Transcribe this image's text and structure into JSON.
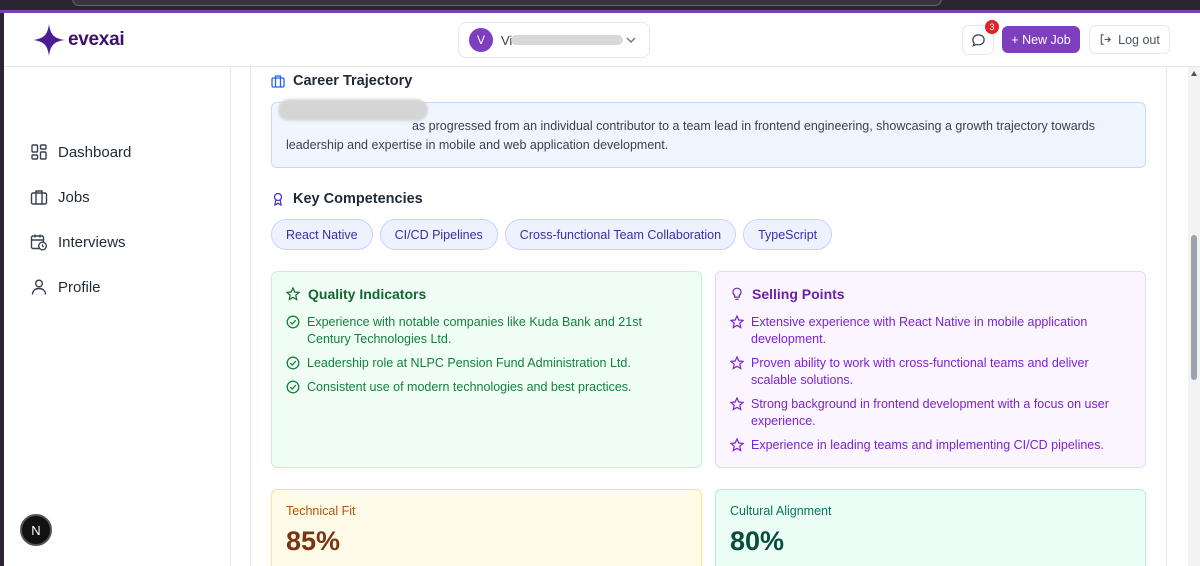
{
  "brand": {
    "name": "evexai",
    "accent": "#7e3fbf"
  },
  "header": {
    "user_initial": "V",
    "user_name": "Vi",
    "messages_count": "3",
    "new_job_label": "+ New Job",
    "logout_label": "Log out"
  },
  "sidebar": {
    "items": [
      {
        "label": "Dashboard",
        "icon": "dashboard-icon"
      },
      {
        "label": "Jobs",
        "icon": "briefcase-icon"
      },
      {
        "label": "Interviews",
        "icon": "calendar-clock-icon"
      },
      {
        "label": "Profile",
        "icon": "user-icon"
      }
    ],
    "help_initial": "N"
  },
  "career": {
    "title": "Career Trajectory",
    "text": "as progressed from an individual contributor to a team lead in frontend engineering, showcasing a growth trajectory towards leadership and expertise in mobile and web application development."
  },
  "competencies": {
    "title": "Key Competencies",
    "tags": [
      "React Native",
      "CI/CD Pipelines",
      "Cross-functional Team Collaboration",
      "TypeScript"
    ]
  },
  "quality": {
    "title": "Quality Indicators",
    "items": [
      "Experience with notable companies like Kuda Bank and 21st Century Technologies Ltd.",
      "Leadership role at NLPC Pension Fund Administration Ltd.",
      "Consistent use of modern technologies and best practices."
    ]
  },
  "selling": {
    "title": "Selling Points",
    "items": [
      "Extensive experience with React Native in mobile application development.",
      "Proven ability to work with cross-functional teams and deliver scalable solutions.",
      "Strong background in frontend development with a focus on user experience.",
      "Experience in leading teams and implementing CI/CD pipelines."
    ]
  },
  "metrics": {
    "technical_label": "Technical Fit",
    "technical_value": "85%",
    "cultural_label": "Cultural Alignment",
    "cultural_value": "80%"
  }
}
